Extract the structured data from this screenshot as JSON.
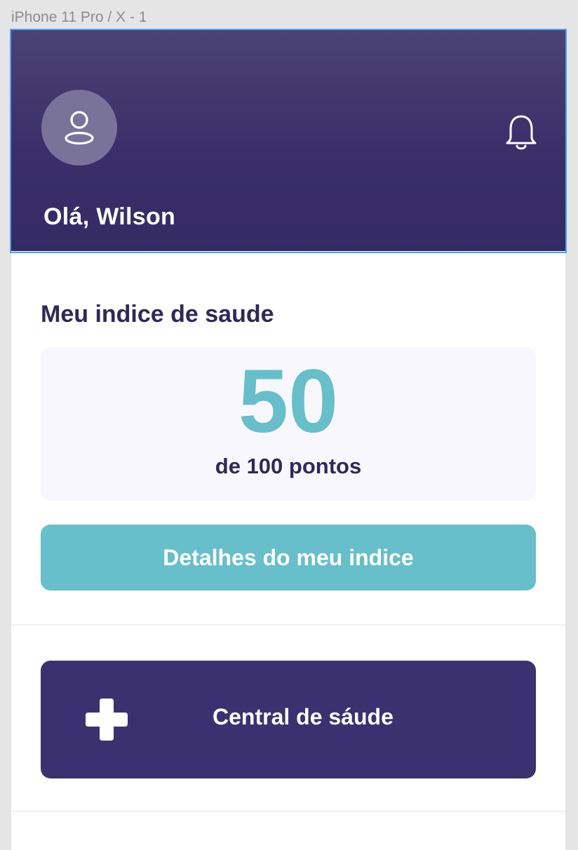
{
  "frame": {
    "label": "iPhone 11 Pro / X - 1"
  },
  "header": {
    "greeting": "Olá, Wilson",
    "avatar_icon": "user-icon",
    "notification_icon": "bell-icon"
  },
  "health_index": {
    "title": "Meu indice de saude",
    "score": "50",
    "caption": "de 100 pontos",
    "details_button": "Detalhes do meu indice"
  },
  "central": {
    "label": "Central de sáude",
    "icon": "plus-cross-icon"
  },
  "colors": {
    "header_bg": "#3a2f69",
    "accent_teal": "#66bfca",
    "primary_purple": "#3c3170",
    "text_dark": "#2f2858",
    "card_bg": "#f8f7fe"
  }
}
